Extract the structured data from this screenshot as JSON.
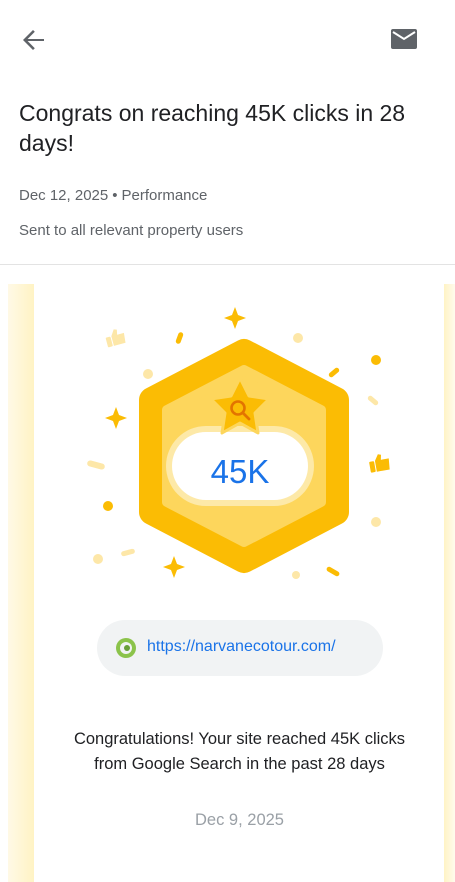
{
  "header": {
    "back_icon": "arrow-back-icon",
    "mail_icon": "mail-icon"
  },
  "message": {
    "title": "Congrats on reaching 45K clicks in 28 days!",
    "date": "Dec 12, 2025",
    "separator": "•",
    "category": "Performance",
    "audience": "Sent to all relevant property users"
  },
  "card": {
    "badge_value": "45K",
    "badge_icon": "star-search-icon",
    "site_url": "https://narvanecotour.com/",
    "site_icon": "site-favicon-icon",
    "body": "Congratulations! Your site reached 45K clicks from Google Search in the past 28 days",
    "date": "Dec 9, 2025"
  },
  "colors": {
    "accent_blue": "#1a73e8",
    "badge_yellow": "#fbbc04",
    "text_secondary": "#5f6368"
  }
}
